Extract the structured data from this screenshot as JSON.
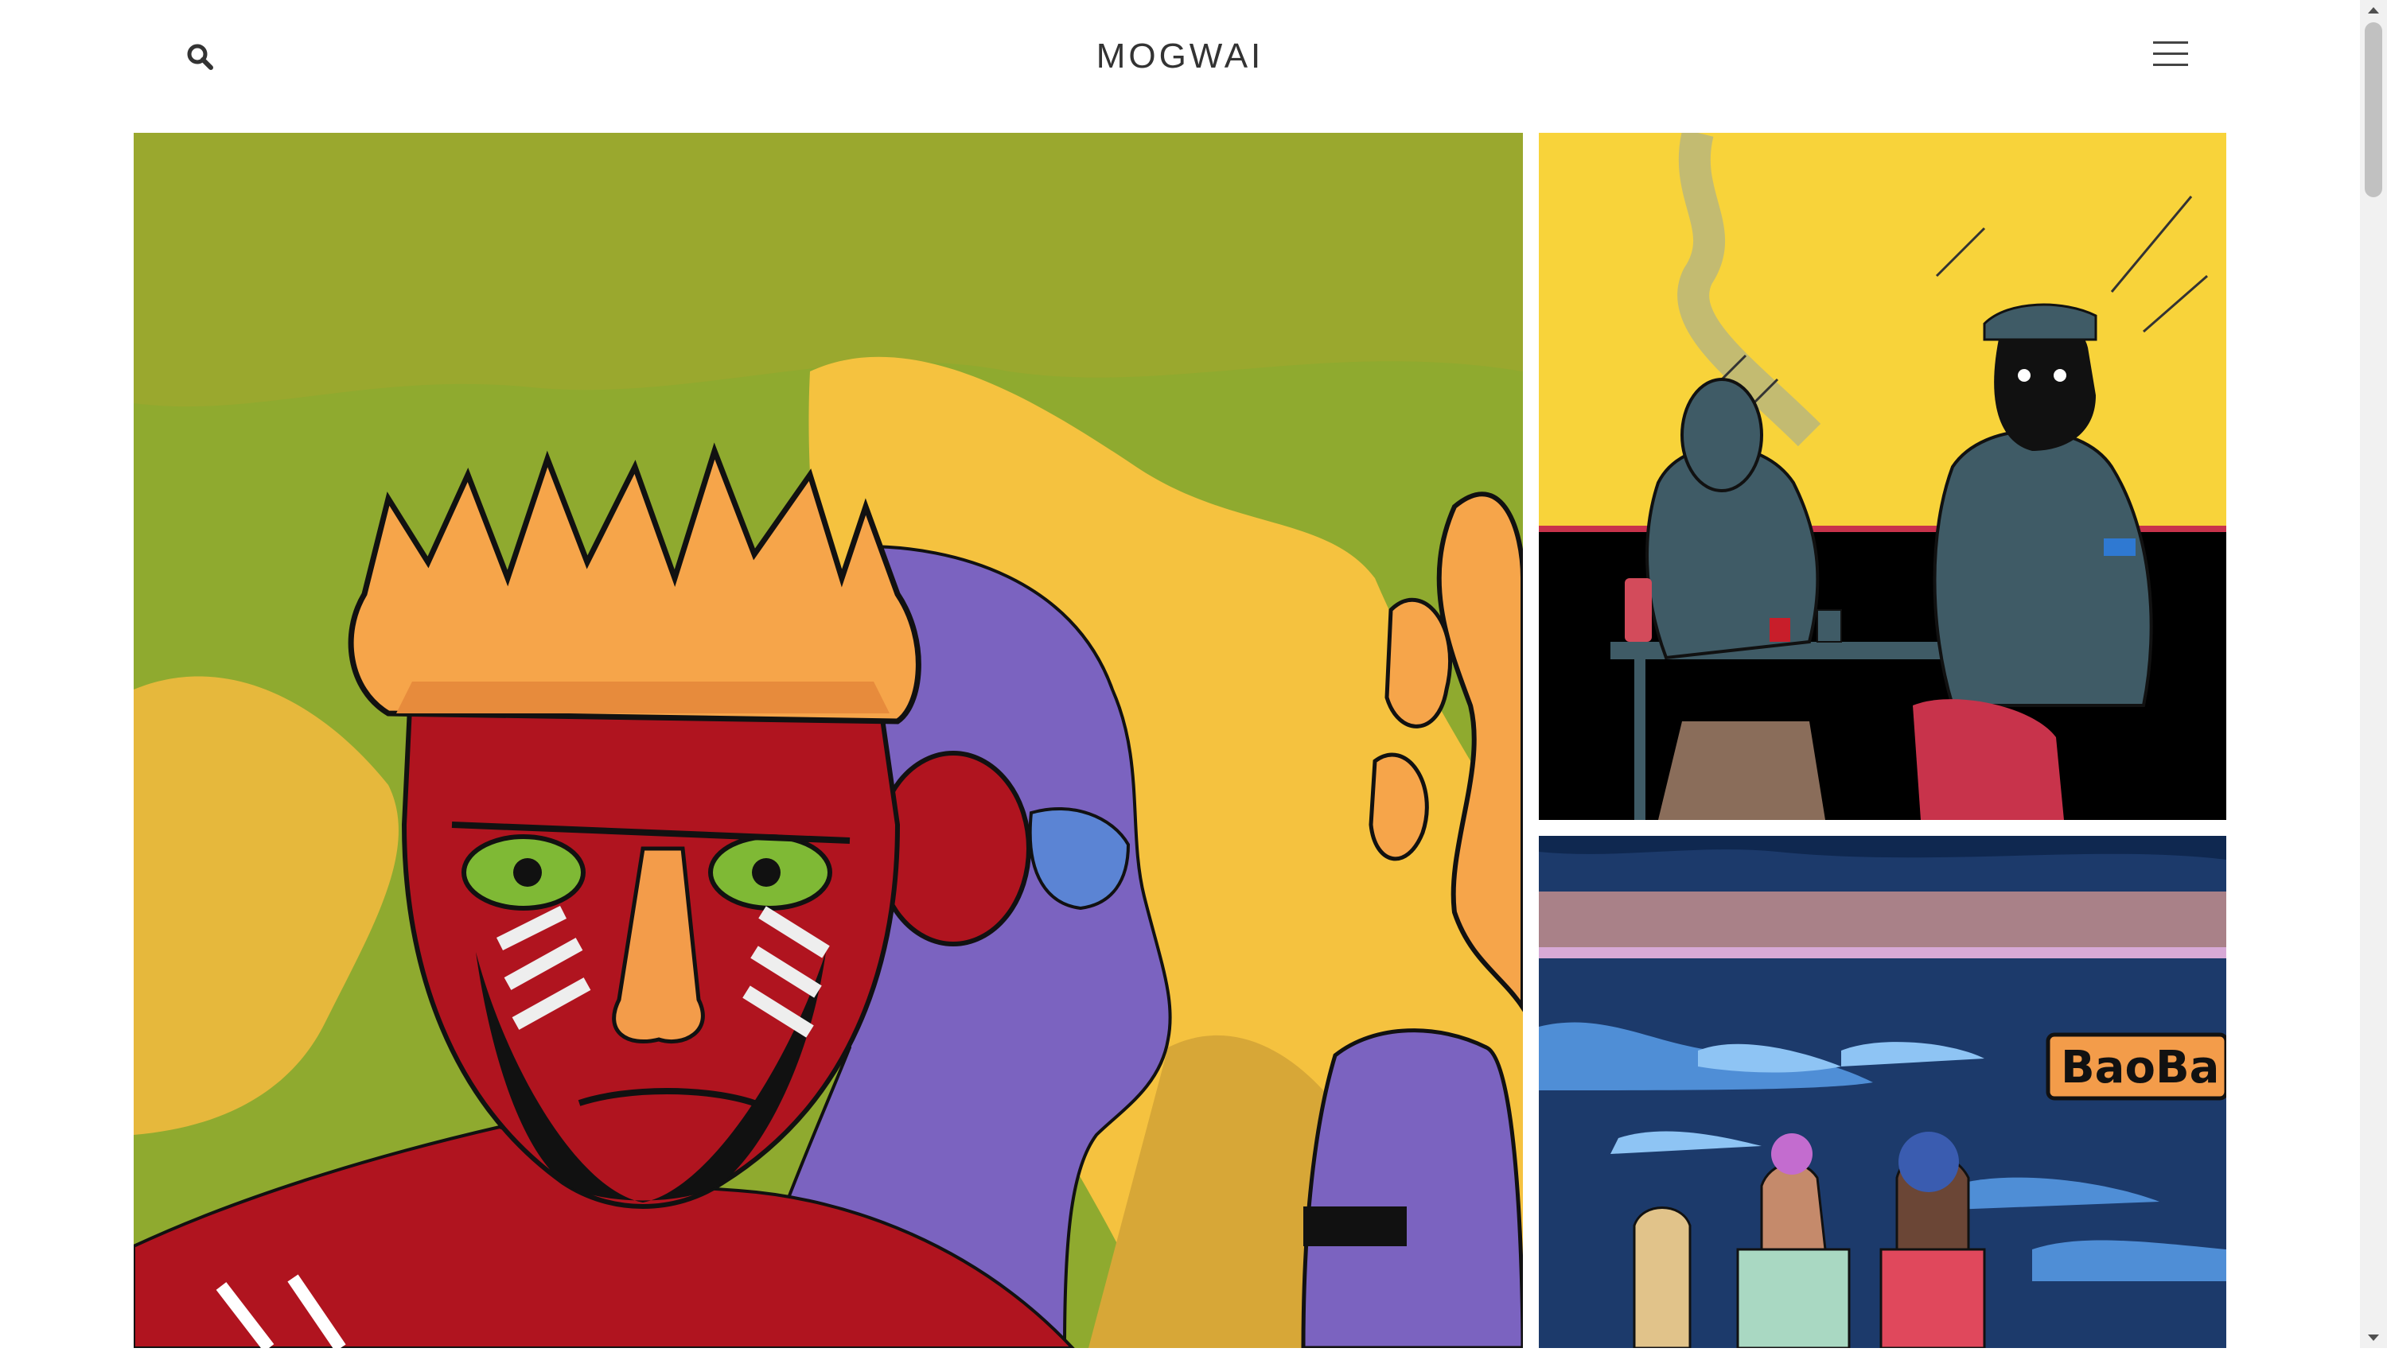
{
  "header": {
    "site_title": "MOGWAI",
    "search_icon": "search-icon",
    "menu_icon": "hamburger-menu-icon"
  },
  "gallery": {
    "tiles": [
      {
        "name": "artwork-crowned-figures",
        "description_icon": "illustration"
      },
      {
        "name": "artwork-smoking-table",
        "description_icon": "illustration"
      },
      {
        "name": "artwork-baobab-night",
        "description_icon": "illustration"
      }
    ],
    "sign_text": "BaoBa"
  },
  "colors": {
    "title": "#333333",
    "background": "#ffffff"
  }
}
